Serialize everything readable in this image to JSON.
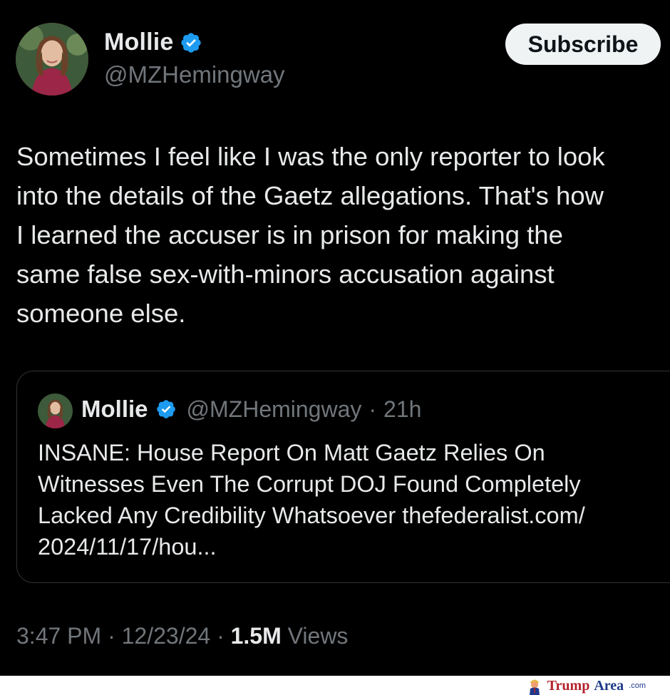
{
  "author": {
    "display_name": "Mollie",
    "handle": "@MZHemingway",
    "avatar_icon": "profile-photo",
    "verified_icon": "verified-badge-icon",
    "verified_color": "#1d9bf0"
  },
  "actions": {
    "subscribe_label": "Subscribe"
  },
  "tweet": {
    "text": "Sometimes I feel like I was the only reporter to look\ninto the details of the Gaetz allegations. That's how\nI learned the accuser is in prison for making the\nsame false sex-with-minors accusation against\nsomeone else."
  },
  "quoted_tweet": {
    "display_name": "Mollie",
    "handle": "@MZHemingway",
    "separator": "·",
    "time": "21h",
    "text": "INSANE: House Report On Matt Gaetz Relies On\nWitnesses Even The Corrupt DOJ Found Completely\nLacked Any Credibility Whatsoever thefederalist.com/\n2024/11/17/hou..."
  },
  "meta": {
    "time": "3:47 PM",
    "separator": "·",
    "date": "12/23/24",
    "views_count": "1.5M",
    "views_label": "Views"
  },
  "watermark": {
    "part1": "Trump",
    "part2": "Area",
    "part3": ".com"
  },
  "colors": {
    "background": "#000000",
    "text_primary": "#e7e9ea",
    "text_secondary": "#71767b",
    "border": "#2f3336",
    "button_bg": "#eff3f4"
  }
}
